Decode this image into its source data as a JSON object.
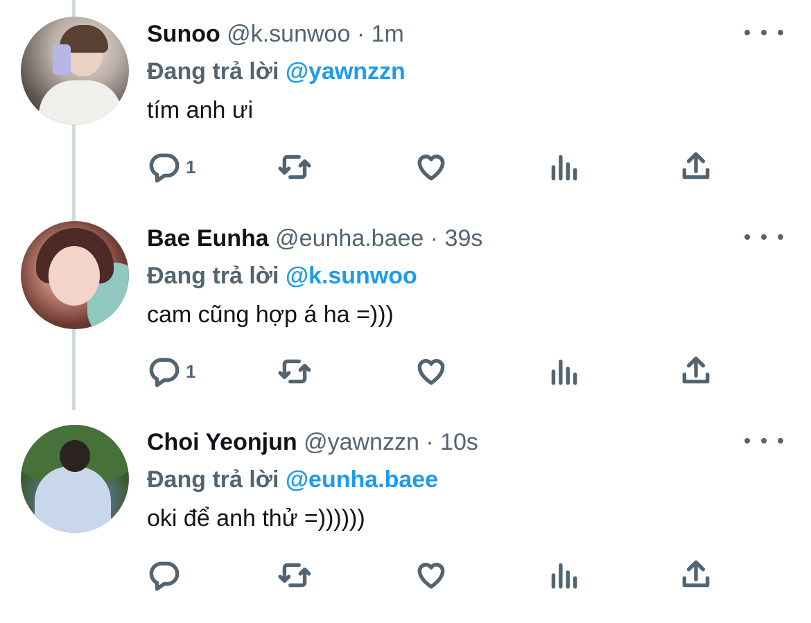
{
  "tweets": [
    {
      "name": "Sunoo",
      "handle": "@k.sunwoo",
      "time": "· 1m",
      "reply_prefix": "Đang trả lời",
      "reply_to": "@yawnzzn",
      "text": "tím anh ưi",
      "reply_count": "1"
    },
    {
      "name": "Bae Eunha",
      "handle": "@eunha.baee",
      "time": "· 39s",
      "reply_prefix": "Đang trả lời",
      "reply_to": "@k.sunwoo",
      "text": "cam cũng hợp á ha =)))",
      "reply_count": "1"
    },
    {
      "name": "Choi Yeonjun",
      "handle": "@yawnzzn",
      "time": "· 10s",
      "reply_prefix": "Đang trả lời",
      "reply_to": "@eunha.baee",
      "text": "oki để anh thử =))))))",
      "reply_count": ""
    }
  ],
  "icons": {
    "reply": "reply-icon",
    "retweet": "retweet-icon",
    "like": "heart-icon",
    "views": "views-icon",
    "share": "share-icon",
    "more": "more-icon"
  },
  "colors": {
    "text": "#0f1419",
    "secondary": "#536471",
    "mention": "#1d9bf0",
    "thread_line": "#cfd9de"
  }
}
